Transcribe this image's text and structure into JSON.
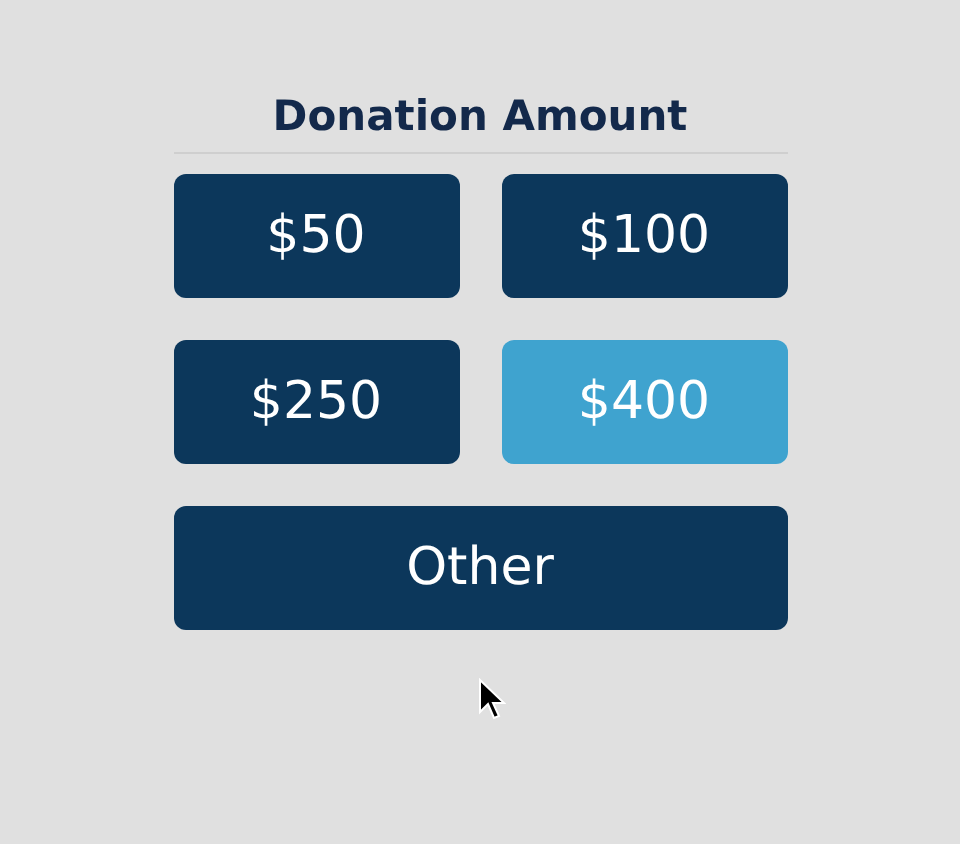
{
  "title": "Donation Amount",
  "amounts": [
    {
      "label": "$50",
      "selected": false
    },
    {
      "label": "$100",
      "selected": false
    },
    {
      "label": "$250",
      "selected": false
    },
    {
      "label": "$400",
      "selected": true
    }
  ],
  "other": {
    "label": "Other",
    "selected": false
  }
}
